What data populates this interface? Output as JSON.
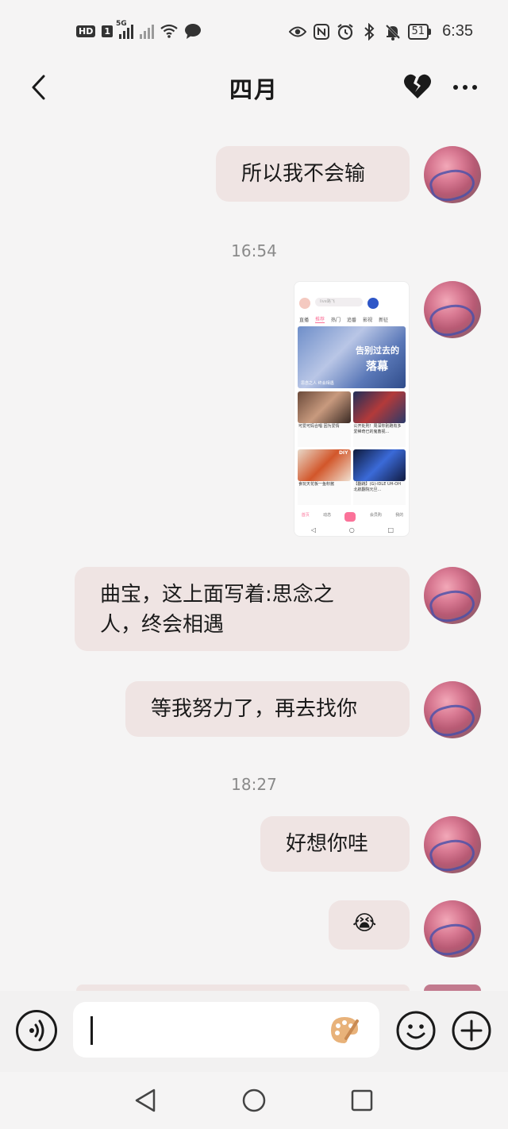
{
  "status_bar": {
    "hd": "HD",
    "sim": "1",
    "network": "5G",
    "battery": "51",
    "time": "6:35"
  },
  "header": {
    "title": "四月"
  },
  "messages": [
    {
      "text": "所以我不会输"
    },
    {
      "timestamp": "16:54"
    },
    {
      "image": "bilibili-screenshot"
    },
    {
      "text": "曲宝，这上面写着:思念之人，终会相遇"
    },
    {
      "text": "等我努力了，再去找你"
    },
    {
      "timestamp": "18:27"
    },
    {
      "text": "好想你哇"
    },
    {
      "emoji": "😭"
    }
  ],
  "texts": {
    "m1": "所以我不会输",
    "ts1": "16:54",
    "m2_line1": "曲宝，这上面写着:思念之",
    "m2_line2": "人，终会相遇",
    "m3": "等我努力了，再去找你",
    "ts2": "18:27",
    "m4": "好想你哇",
    "m5": "😭"
  },
  "screenshot": {
    "search_placeholder": "live路飞",
    "tabs": [
      "直播",
      "推荐",
      "热门",
      "追番",
      "影视",
      "新征"
    ],
    "active_tab": "推荐",
    "banner_title_1": "告别过去的",
    "banner_title_2": "落幕",
    "banner_caption": "思念之人 终会相遇",
    "cards": [
      {
        "caption": "可爱可妈合唱 因为爱情",
        "sub": "1个粉丝"
      },
      {
        "caption": "公开处刑！周深你别跑有多爱稀奇已的鬼畜视…",
        "sub": "两色120吗道温日"
      },
      {
        "caption": "食玩天花板一鱼籽酱",
        "sub": "1万点赞"
      },
      {
        "caption": "【翻跳】(G)-IDLE UH-OH 北航翻院元旦…",
        "sub": "北航翻院元旦大赏"
      }
    ],
    "card_badge": "DIY",
    "nav": [
      "首页",
      "动态",
      "+",
      "会员购",
      "我的"
    ]
  },
  "colors": {
    "bubble": "#efe4e3",
    "background": "#f5f4f4",
    "accent_pink": "#fb7299"
  }
}
